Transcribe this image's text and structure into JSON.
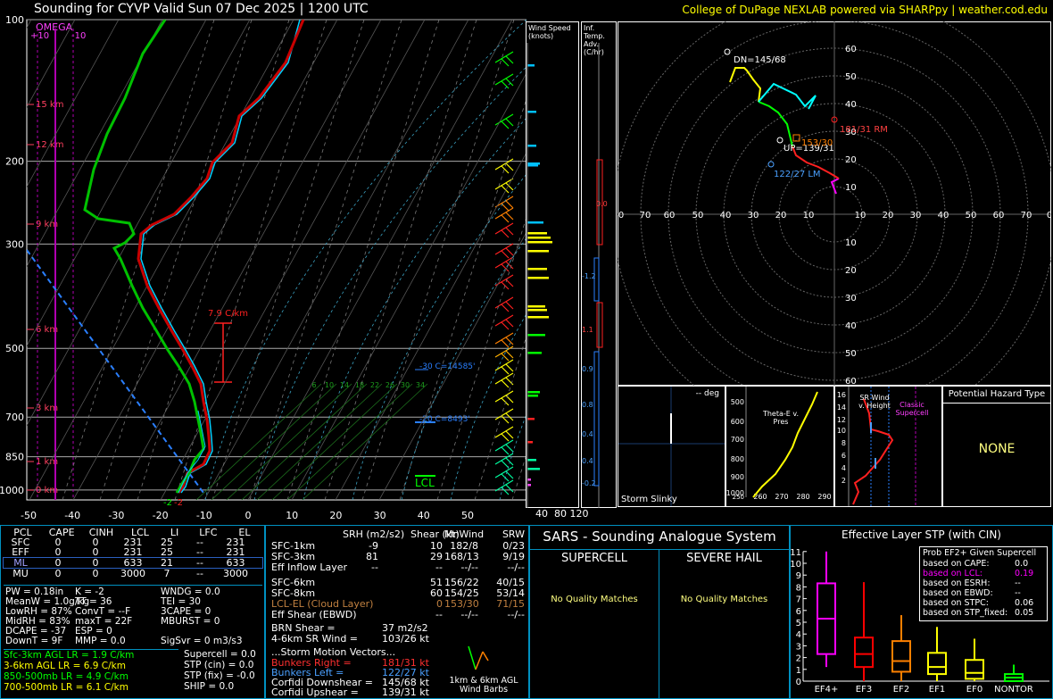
{
  "header": {
    "title": "Sounding for CYVP Valid  Sun 07 Dec 2025 | 1200 UTC",
    "credit": "College of DuPage NEXLAB powered via SHARPpy | weather.cod.edu"
  },
  "skewt": {
    "pressure_labels": [
      "100",
      "200",
      "300",
      "500",
      "700",
      "850",
      "1000"
    ],
    "temp_labels": [
      "-50",
      "-40",
      "-30",
      "-20",
      "-10",
      "0",
      "10",
      "20",
      "30",
      "40",
      "50"
    ],
    "height_labels": [
      "15 km",
      "12 km",
      "9 km",
      "6 km",
      "3 km",
      "1 km",
      "0 km"
    ],
    "omega_label": "OMEGA",
    "omega_ticks": [
      "+10",
      "-10"
    ],
    "lapse_label": "7.9 C/km",
    "iso_label_30": "-30 C=14585'",
    "iso_label_20": "-20 C=8493'",
    "lcl_label": "LCL",
    "mixing_ratios": [
      "6",
      "10",
      "14",
      "18",
      "22",
      "26",
      "30",
      "34"
    ],
    "sfc_temp": "-2",
    "sfc_dew": "-2"
  },
  "wind_panel": {
    "title": "Wind Speed (knots)",
    "labels": [
      "40",
      "80",
      "120"
    ]
  },
  "adv_panel": {
    "title": "Inf. Temp. Adv. (C/hr)",
    "values": [
      "0.0",
      "-1.2",
      "1.1",
      "0.9",
      "0.8",
      "0.4",
      "0.4",
      "-0.2"
    ]
  },
  "hodograph": {
    "ring_labels": [
      "60",
      "50",
      "40",
      "30",
      "20",
      "10",
      "10",
      "20",
      "30",
      "40",
      "50",
      "60"
    ],
    "x_labels": [
      "0",
      "70",
      "60",
      "50",
      "40",
      "30",
      "20",
      "10",
      "10",
      "20",
      "30",
      "40",
      "50",
      "60",
      "70",
      "0"
    ],
    "dn": "DN=145/68",
    "up": "UP=139/31",
    "rm": "181/31 RM",
    "lm": "122/27 LM",
    "mean": "153/30"
  },
  "slinky": {
    "deg": "-- deg",
    "label": "Storm Slinky"
  },
  "thetae": {
    "title": "Theta-E v. Pres",
    "y_labels": [
      "500",
      "600",
      "700",
      "800",
      "900",
      "1000"
    ],
    "x_labels": [
      "260",
      "270",
      "280",
      "290"
    ],
    "y_top": "250"
  },
  "srwind": {
    "title": "SR Wind v. Height",
    "tag": "Classic Supercell",
    "y_labels": [
      "16",
      "14",
      "12",
      "10",
      "8",
      "6",
      "4",
      "2"
    ]
  },
  "hazard": {
    "title": "Potential Hazard Type",
    "value": "NONE"
  },
  "parcels": {
    "headers": [
      "PCL",
      "CAPE",
      "CINH",
      "LCL",
      "LI",
      "LFC",
      "EL"
    ],
    "rows": [
      [
        "SFC",
        "0",
        "0",
        "231",
        "25",
        "--",
        "231"
      ],
      [
        "EFF",
        "0",
        "0",
        "231",
        "25",
        "--",
        "231"
      ],
      [
        "ML",
        "0",
        "0",
        "633",
        "21",
        "--",
        "633"
      ],
      [
        "MU",
        "0",
        "0",
        "3000",
        "7",
        "--",
        "3000"
      ]
    ]
  },
  "indices": {
    "col1": [
      "PW = 0.18in",
      "MeanW = 1.0g/kg",
      "LowRH = 87%",
      "MidRH = 83%",
      "DCAPE = -37",
      "DownT = 9F"
    ],
    "col2": [
      "K = -2",
      "TT = 36",
      "ConvT = --F",
      "maxT = 22F",
      "ESP = 0",
      "MMP = 0.0"
    ],
    "col3": [
      "WNDG = 0.0",
      "TEI = 30",
      "3CAPE = 0",
      "MBURST = 0",
      "",
      "SigSvr = 0 m3/s3"
    ]
  },
  "lapse_rates": [
    {
      "text": "Sfc-3km AGL LR = 1.9 C/km",
      "color": "#00ff00"
    },
    {
      "text": "3-6km AGL LR = 6.9 C/km",
      "color": "#ffff00"
    },
    {
      "text": "850-500mb LR = 4.9 C/km",
      "color": "#00ff00"
    },
    {
      "text": "700-500mb LR = 6.1 C/km",
      "color": "#ffff00"
    }
  ],
  "supercell_params": [
    "Supercell = 0.0",
    "STP (cin) = 0.0",
    "STP (fix) = -0.0",
    "SHIP = 0.0"
  ],
  "kinematics": {
    "headers": [
      "SRH (m2/s2)",
      "Shear (kt)",
      "MnWind",
      "SRW"
    ],
    "rows": [
      {
        "label": "SFC-1km",
        "srh": "-9",
        "shear": "10",
        "mn": "182/8",
        "srw": "0/23",
        "color": "#ffffff"
      },
      {
        "label": "SFC-3km",
        "srh": "81",
        "shear": "29",
        "mn": "168/13",
        "srw": "9/19",
        "color": "#ffffff"
      },
      {
        "label": "Eff Inflow Layer",
        "srh": "--",
        "shear": "--",
        "mn": "--/--",
        "srw": "--/--",
        "color": "#ffffff"
      },
      {
        "label": "SFC-6km",
        "srh": "51",
        "shear": "156/22",
        "mn": "",
        "srw": "40/15",
        "color": "#ffffff"
      },
      {
        "label": "SFC-8km",
        "srh": "60",
        "shear": "154/25",
        "mn": "",
        "srw": "53/14",
        "color": "#ffffff"
      },
      {
        "label": "LCL-EL (Cloud Layer)",
        "srh": "0",
        "shear": "153/30",
        "mn": "",
        "srw": "71/15",
        "color": "#c08040"
      },
      {
        "label": "Eff Shear (EBWD)",
        "srh": "--",
        "shear": "--/--",
        "mn": "",
        "srw": "--/--",
        "color": "#ffffff"
      }
    ],
    "brn": "BRN Shear =",
    "brn_v": "37 m2/s2",
    "sr46": "4-6km SR Wind =",
    "sr46_v": "103/26 kt",
    "storm_title": "...Storm Motion Vectors...",
    "storm": [
      {
        "label": "Bunkers Right =",
        "value": "181/31 kt",
        "color": "#ff3030"
      },
      {
        "label": "Bunkers Left =",
        "value": "122/27 kt",
        "color": "#4aa0ff"
      },
      {
        "label": "Corfidi Downshear =",
        "value": "145/68 kt",
        "color": "#ffffff"
      },
      {
        "label": "Corfidi Upshear =",
        "value": "139/31 kt",
        "color": "#ffffff"
      }
    ],
    "barbs_label": "1km & 6km AGL Wind Barbs"
  },
  "sars": {
    "title": "SARS - Sounding Analogue System",
    "supercell": "SUPERCELL",
    "hail": "SEVERE HAIL",
    "match1": "No Quality Matches",
    "match2": "No Quality Matches"
  },
  "stp": {
    "title": "Effective Layer STP (with CIN)",
    "box_title": "Prob EF2+ Given Supercell",
    "probs": [
      {
        "label": "based on CAPE:",
        "value": "0.0",
        "color": "#ffffff"
      },
      {
        "label": "based on LCL:",
        "value": "0.19",
        "color": "#ff00ff"
      },
      {
        "label": "based on ESRH:",
        "value": "--",
        "color": "#ffffff"
      },
      {
        "label": "based on EBWD:",
        "value": "--",
        "color": "#ffffff"
      },
      {
        "label": "based on STPC:",
        "value": "0.06",
        "color": "#ffffff"
      },
      {
        "label": "based on STP_fixed:",
        "value": "0.05",
        "color": "#ffffff"
      }
    ],
    "y_labels": [
      "11",
      "10",
      "9",
      "8",
      "7",
      "6",
      "5",
      "4",
      "3",
      "2",
      "1",
      "0"
    ],
    "categories": [
      "EF4+",
      "EF3",
      "EF2",
      "EF1",
      "EF0",
      "NONTOR"
    ]
  },
  "chart_data": {
    "type": "line",
    "title": "Sounding for CYVP Valid  Sun 07 Dec 2025 | 1200 UTC",
    "xlabel": "",
    "ylabel": "",
    "xlim": [
      -50,
      50
    ],
    "ylim": [
      1000,
      100
    ],
    "series": [
      {
        "name": "",
        "color": "#e00000",
        "points": [
          [
            1000,
            -2
          ],
          [
            925,
            -9
          ],
          [
            850,
            -9
          ],
          [
            700,
            -11
          ],
          [
            600,
            -17
          ],
          [
            500,
            -25
          ],
          [
            400,
            -34
          ],
          [
            350,
            -40
          ],
          [
            300,
            -50
          ],
          [
            250,
            -55
          ],
          [
            200,
            -57
          ],
          [
            150,
            -57
          ],
          [
            100,
            -59
          ]
        ]
      },
      {
        "name": "",
        "color": "#00c000",
        "points": [
          [
            1000,
            -2
          ],
          [
            925,
            -8
          ],
          [
            850,
            -10
          ],
          [
            700,
            -14
          ],
          [
            600,
            -20
          ],
          [
            500,
            -29
          ],
          [
            400,
            -42
          ],
          [
            350,
            -47
          ],
          [
            300,
            -56
          ],
          [
            250,
            -66
          ],
          [
            200,
            -70
          ],
          [
            150,
            -72
          ],
          [
            100,
            -78
          ]
        ]
      }
    ],
    "stp_boxes": [
      {
        "cat": "EF4+",
        "min": 1.2,
        "q1": 2.3,
        "median": 5.3,
        "q3": 8.3,
        "max": 11.0,
        "color": "#ff00ff"
      },
      {
        "cat": "EF3",
        "min": 0.0,
        "q1": 1.2,
        "median": 2.3,
        "q3": 3.7,
        "max": 8.4,
        "color": "#ff0000"
      },
      {
        "cat": "EF2",
        "min": 0.0,
        "q1": 0.8,
        "median": 1.7,
        "q3": 3.4,
        "max": 5.6,
        "color": "#ff8000"
      },
      {
        "cat": "EF1",
        "min": 0.0,
        "q1": 0.6,
        "median": 1.2,
        "q3": 2.4,
        "max": 4.6,
        "color": "#ffff00"
      },
      {
        "cat": "EF0",
        "min": 0.0,
        "q1": 0.2,
        "median": 0.7,
        "q3": 1.8,
        "max": 3.6,
        "color": "#ffff00"
      },
      {
        "cat": "NONTOR",
        "min": 0.0,
        "q1": 0.0,
        "median": 0.3,
        "q3": 0.6,
        "max": 1.4,
        "color": "#00ff00"
      }
    ]
  }
}
